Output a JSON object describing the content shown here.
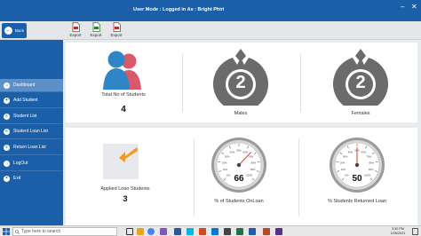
{
  "header": {
    "user_mode": "User Mode : Logged in As :   Bright Phiri",
    "minimize": "–",
    "close": "✕"
  },
  "toolbar": {
    "back_label": "Back",
    "exports": [
      {
        "label": "Export",
        "icon": "pdf-icon",
        "color": "#c62828"
      },
      {
        "label": "Export",
        "icon": "excel-icon",
        "color": "#2e7d32"
      },
      {
        "label": "Export",
        "icon": "pdf-icon",
        "color": "#c62828"
      }
    ]
  },
  "sidebar": {
    "items": [
      {
        "label": "Dashboard",
        "icon": "home-icon",
        "active": true
      },
      {
        "label": "Add Student",
        "icon": "plus-icon",
        "active": false
      },
      {
        "label": "Student List",
        "icon": "list-icon",
        "active": false
      },
      {
        "label": "Student Loan List",
        "icon": "list-icon",
        "active": false
      },
      {
        "label": "Return Loan List",
        "icon": "list-icon",
        "active": false
      },
      {
        "label": "LogOut",
        "icon": "logout-icon",
        "active": false
      },
      {
        "label": "Exit",
        "icon": "exit-icon",
        "active": false
      }
    ]
  },
  "dashboard": {
    "total_students": {
      "label": "Total No of Students",
      "value": "4"
    },
    "males": {
      "label": "Males",
      "value": "2"
    },
    "females": {
      "label": "Females",
      "value": "2"
    },
    "applied_loans": {
      "label": "Applied Loan Students",
      "value": "3"
    },
    "on_loan": {
      "label": "% of Students OnLoan",
      "value": "66",
      "percent": 66
    },
    "returned": {
      "label": "% Students Returned Loan",
      "value": "50",
      "percent": 50
    },
    "gauge_ticks": [
      "0%",
      "10%",
      "20%",
      "30%",
      "40%",
      "50%",
      "60%",
      "70%",
      "80%",
      "90%",
      "100%"
    ]
  },
  "taskbar": {
    "search_placeholder": "Type here to search",
    "time": "3:30 PM",
    "date": "1/26/2021"
  },
  "colors": {
    "primary": "#1a5fa8",
    "sidebar_active": "#5d8fc9",
    "badge_dark": "#6b6b6b",
    "male_blue": "#2e86c9",
    "female_pink": "#d9596a",
    "arrow_orange": "#f29a1f"
  }
}
